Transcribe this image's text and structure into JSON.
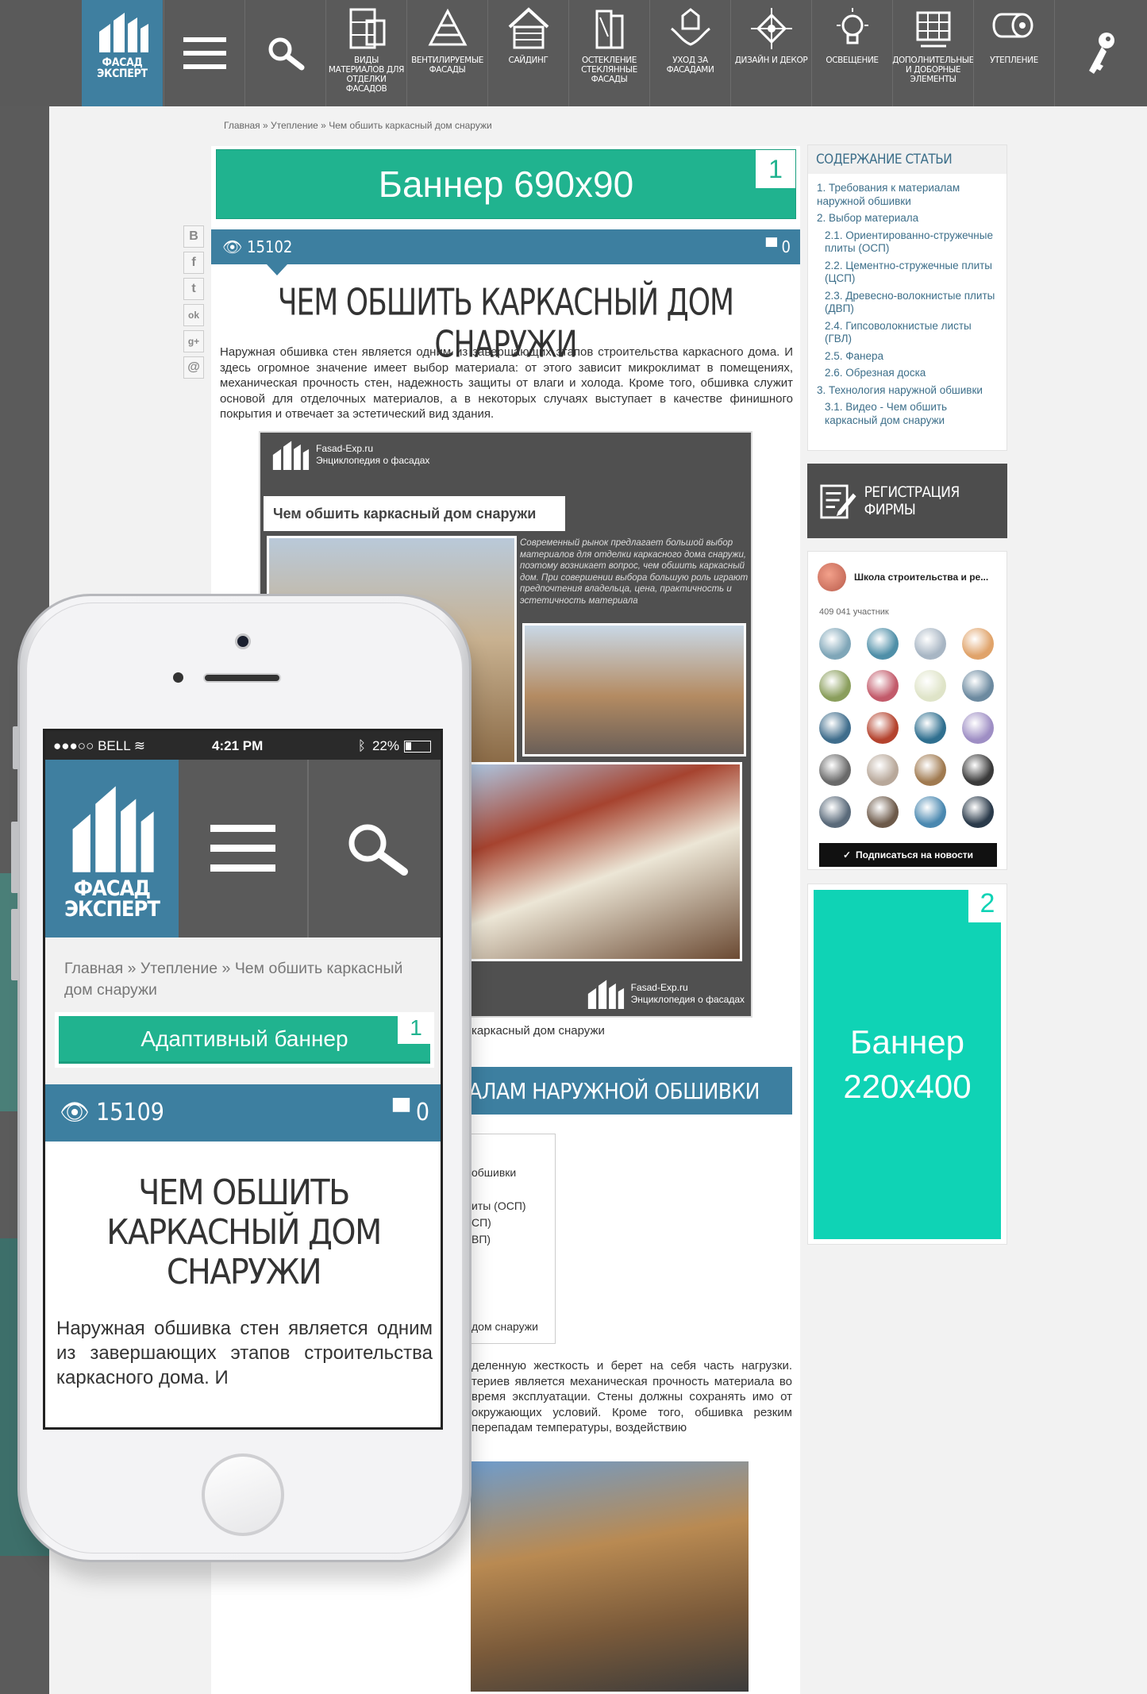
{
  "nav": {
    "logo_text": "ФАСАД\nЭКСПЕРТ",
    "items": [
      {
        "label": "Виды материалов для отделки фасадов",
        "icon": "bricks-icon"
      },
      {
        "label": "Вентилируемые фасады",
        "icon": "facade-icon"
      },
      {
        "label": "Сайдинг",
        "icon": "house-icon"
      },
      {
        "label": "Остекление стеклянные фасады",
        "icon": "glass-icon"
      },
      {
        "label": "Уход за фасадами",
        "icon": "hands-icon"
      },
      {
        "label": "Дизайн и декор",
        "icon": "decor-icon"
      },
      {
        "label": "Освещение",
        "icon": "bulb-icon"
      },
      {
        "label": "Дополнительные и доборные элементы",
        "icon": "panel-icon"
      },
      {
        "label": "Утепление",
        "icon": "roll-icon"
      }
    ]
  },
  "breadcrumb": "Главная » Утепление » Чем обшить каркасный дом снаружи",
  "banner_top": {
    "text": "Баннер 690x90",
    "num": "1"
  },
  "stats": {
    "views": "15102",
    "comments": "0"
  },
  "share": [
    "В",
    "f",
    "t",
    "ok",
    "g+",
    "@"
  ],
  "article": {
    "title": "ЧЕМ ОБШИТЬ КАРКАСНЫЙ ДОМ СНАРУЖИ",
    "intro": "Наружная обшивка стен является одним из завершающих этапов строительства каркасного дома. И здесь огромное значение имеет выбор материала: от этого зависит микроклимат в помещениях, механическая прочность стен, надежность защиты от влаги и холода. Кроме того, обшивка служит основой для отделочных материалов, а в некоторых случаях выступает в качестве финишного покрытия и отвечает за эстетический вид здания."
  },
  "infographic": {
    "brand_line1": "Fasad-Exp.ru",
    "brand_line2": "Энциклопедия о фасадах",
    "title": "Чем обшить каркасный дом снаружи",
    "description": "Современный рынок предлагает большой выбор материалов для отделки каркасного дома снаружи, поэтому возникает вопрос, чем обшить каркасный дом. При совершении выбора большую роль играют предпочтения владельца, цена, практичность и эстетичность материала"
  },
  "caption_fragment": "каркасный дом снаружи",
  "h2_fragment": "АЛАМ НАРУЖНОЙ ОБШИВКИ",
  "toc2_fragments": [
    "обшивки",
    "иты (ОСП)",
    "СП)",
    "ВП)",
    "дом снаружи"
  ],
  "body2_fragment": "деленную жесткость и берет на себя часть нагрузки. териев является механическая прочность материала во время эксплуатации. Стены должны сохранять имо от окружающих условий. Кроме того, обшивка резким перепадам температуры, воздействию",
  "toc": {
    "header": "СОДЕРЖАНИЕ СТАТЬИ",
    "items": [
      {
        "text": "1. Требования к материалам наружной обшивки",
        "sub": false
      },
      {
        "text": "2. Выбор материала",
        "sub": false
      },
      {
        "text": "2.1. Ориентированно-стружечные плиты (ОСП)",
        "sub": true
      },
      {
        "text": "2.2. Цементно-стружечные плиты (ЦСП)",
        "sub": true
      },
      {
        "text": "2.3. Древесно-волокнистые плиты (ДВП)",
        "sub": true
      },
      {
        "text": "2.4. Гипсоволокнистые листы (ГВЛ)",
        "sub": true
      },
      {
        "text": "2.5. Фанера",
        "sub": true
      },
      {
        "text": "2.6. Обрезная доска",
        "sub": true
      },
      {
        "text": "3. Технология наружной обшивки",
        "sub": false
      },
      {
        "text": "3.1. Видео - Чем обшить каркасный дом снаружи",
        "sub": true
      }
    ]
  },
  "register_button": "РЕГИСТРАЦИЯ ФИРМЫ",
  "vk_widget": {
    "group_name": "Школа строительства и ре...",
    "members": "409 041 участник",
    "subscribe": "Подписаться на новости",
    "avatar_colors": [
      "#7fa6b8",
      "#4f8fa8",
      "#a8b6c4",
      "#e0a36a",
      "#8a9e5c",
      "#c25a6a",
      "#dfe4c8",
      "#6c8aa0",
      "#3f6d8c",
      "#b4432e",
      "#2f6f8f",
      "#9e8ec4",
      "#6a6a6a",
      "#b8a89a",
      "#a07a50",
      "#3a3a3a",
      "#5a6a7a",
      "#6d5a4a",
      "#4a88b0",
      "#2a3a4a"
    ]
  },
  "banner_side": {
    "text": "Баннер 220x400",
    "num": "2"
  },
  "phone": {
    "carrier": "●●●○○ BELL",
    "time": "4:21 PM",
    "battery": "22%",
    "logo_text": "ФАСАД\nЭКСПЕРТ",
    "breadcrumb": "Главная » Утепление » Чем обшить каркасный дом снаружи",
    "banner": {
      "text": "Адаптивный баннер",
      "num": "1"
    },
    "views": "15109",
    "comments": "0",
    "title": "ЧЕМ ОБШИТЬ КАРКАСНЫЙ ДОМ СНАРУЖИ",
    "text": "Наружная обшивка стен является одним из завершающих этапов строительства каркасного дома. И"
  }
}
